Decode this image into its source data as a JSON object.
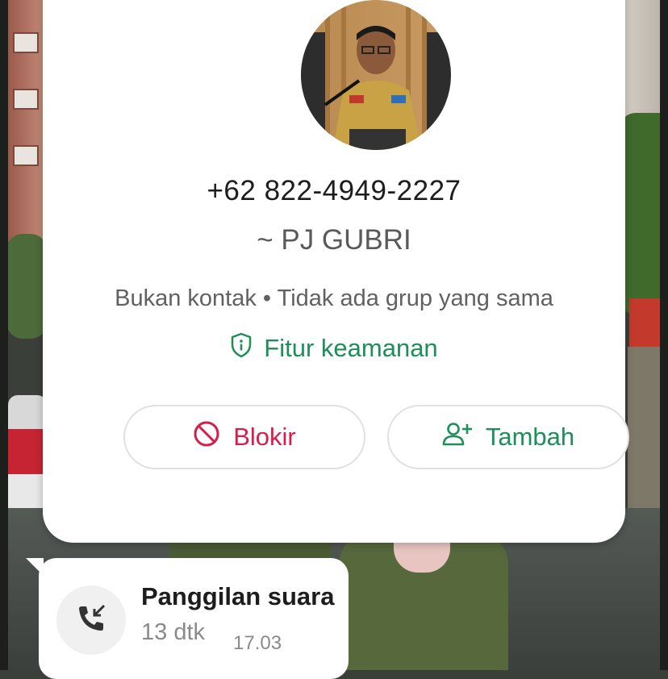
{
  "contact": {
    "phone": "+62 822-4949-2227",
    "push_name": "~ PJ GUBRI",
    "info": "Bukan kontak • Tidak ada grup yang sama",
    "security_label": "Fitur keamanan",
    "avatar_icon": "profile-photo"
  },
  "actions": {
    "block_label": "Blokir",
    "block_icon": "block-icon",
    "add_label": "Tambah",
    "add_icon": "add-person-icon"
  },
  "call_message": {
    "title": "Panggilan suara",
    "duration": "13 dtk",
    "time": "17.03",
    "icon": "incoming-call-icon"
  },
  "colors": {
    "accent_green": "#1e8e5a",
    "block_red": "#d61e4a",
    "card_bg": "#ffffff"
  }
}
